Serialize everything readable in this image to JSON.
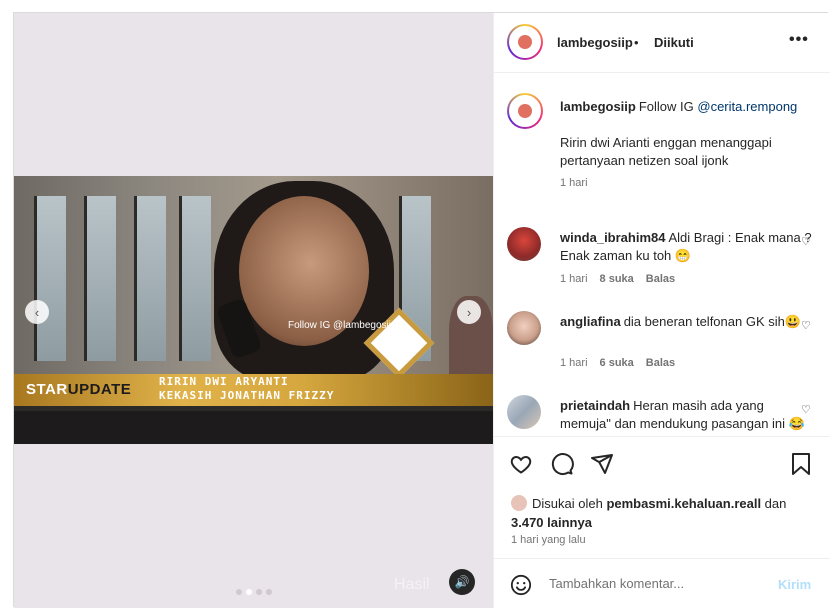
{
  "colors": {
    "link": "#00376b",
    "muted": "#737373",
    "post_disabled": "#b2dffc",
    "accent_gold": "#d6a73e"
  },
  "media": {
    "overlay_follow": "Follow IG @lambegosiip",
    "lower_third_brand_a": "STAR",
    "lower_third_brand_b": "UPDATE",
    "lower_third_line1": "RIRIN DWI ARYANTI",
    "lower_third_line2": "KEKASIH JONATHAN FRIZZY",
    "watermark": "Hasil",
    "prev_icon": "chevron-left-icon",
    "next_icon": "chevron-right-icon",
    "mute_icon": "volume-icon",
    "carousel_total": 4,
    "carousel_active": 2
  },
  "header": {
    "username": "lambegosiip",
    "separator": "•",
    "follow_status": "Diikuti",
    "more": "•••"
  },
  "caption": {
    "username": "lambegosiip",
    "text_prefix": "Follow IG ",
    "mention": "@cerita.rempong",
    "body": "Ririn dwi Arianti enggan menanggapi pertanyaan netizen soal ijonk",
    "time": "1 hari"
  },
  "comments": [
    {
      "username": "winda_ibrahim84",
      "text": "Aldi Bragi : Enak mana ? Enak zaman ku toh 😁",
      "time": "1 hari",
      "likes": "8 suka",
      "reply": "Balas"
    },
    {
      "username": "angliafina",
      "text": "dia beneran telfonan GK sih😃",
      "time": "1 hari",
      "likes": "6 suka",
      "reply": "Balas"
    },
    {
      "username": "prietaindah",
      "text": "Heran masih ada yang memuja\" dan mendukung pasangan ini 😂",
      "time": "",
      "likes": "",
      "reply": ""
    }
  ],
  "likes": {
    "prefix": "Disukai oleh ",
    "top_user": "pembasmi.kehaluan.reall",
    "middle": " dan ",
    "others": "3.470 lainnya"
  },
  "post_time": "1 hari yang lalu",
  "compose": {
    "placeholder": "Tambahkan komentar...",
    "post_label": "Kirim"
  }
}
